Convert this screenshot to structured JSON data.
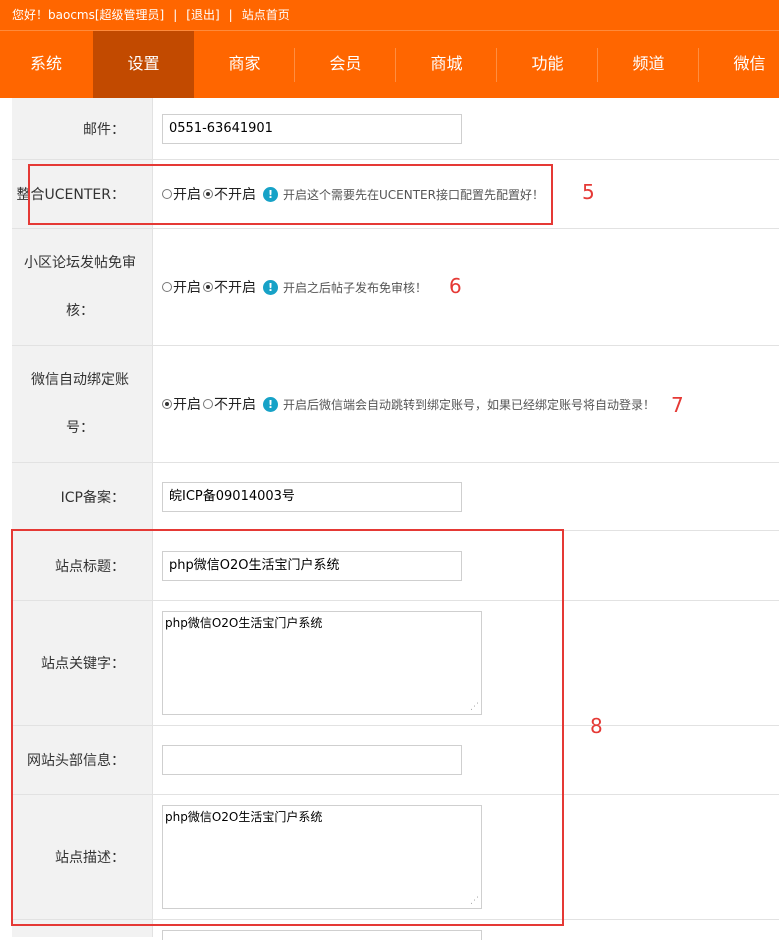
{
  "topbar": {
    "greeting": "您好！baocms[超级管理员]",
    "sep1": "|",
    "logout": "[退出]",
    "sep2": "|",
    "home": "站点首页"
  },
  "nav": {
    "tabs": [
      "系统",
      "设置",
      "商家",
      "会员",
      "商城",
      "功能",
      "频道",
      "微信"
    ],
    "active": "设置"
  },
  "form": {
    "mail": {
      "label": "邮件：",
      "value": "0551-63641901"
    },
    "ucenter": {
      "label": "整合UCENTER：",
      "opt_on": "开启",
      "opt_off": "不开启",
      "selected": "不开启",
      "tip": "开启这个需要先在UCENTER接口配置先配置好！"
    },
    "forum": {
      "label": "小区论坛发帖免审核：",
      "opt_on": "开启",
      "opt_off": "不开启",
      "selected": "不开启",
      "tip": "开启之后帖子发布免审核！"
    },
    "wechat_bind": {
      "label": "微信自动绑定账号：",
      "opt_on": "开启",
      "opt_off": "不开启",
      "selected": "开启",
      "tip": "开启后微信端会自动跳转到绑定账号，如果已经绑定账号将自动登录！"
    },
    "icp": {
      "label": "ICP备案：",
      "value": "皖ICP备09014003号"
    },
    "site_title": {
      "label": "站点标题：",
      "value": "php微信O2O生活宝门户系统"
    },
    "keywords": {
      "label": "站点关键字：",
      "value": "php微信O2O生活宝门户系统"
    },
    "header_info": {
      "label": "网站头部信息：",
      "value": ""
    },
    "description": {
      "label": "站点描述：",
      "value": "php微信O2O生活宝门户系统"
    }
  },
  "annotations": {
    "n5": "5",
    "n6": "6",
    "n7": "7",
    "n8": "8"
  },
  "icons": {
    "tip": "info-exclamation-icon",
    "resize": "resize-grip-icon"
  },
  "colors": {
    "brand": "#ff6600",
    "active_tab": "#c24a00",
    "annotation": "#e53935",
    "tip": "#17a2c7"
  }
}
